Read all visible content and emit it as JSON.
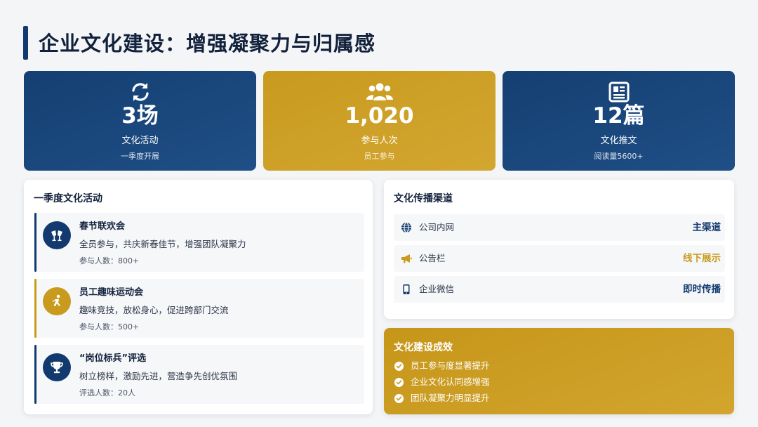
{
  "page": {
    "title": "企业文化建设：增强凝聚力与归属感"
  },
  "colors": {
    "navy": "#123a6e",
    "gold": "#c89a1e",
    "text": "#13223c"
  },
  "stats": [
    {
      "icon": "refresh-icon",
      "value": "3场",
      "label": "文化活动",
      "sub": "一季度开展"
    },
    {
      "icon": "people-icon",
      "value": "1,020",
      "label": "参与人次",
      "sub": "员工参与"
    },
    {
      "icon": "newspaper-icon",
      "value": "12篇",
      "label": "文化推文",
      "sub": "阅读量5600+"
    }
  ],
  "activities": {
    "title": "一季度文化活动",
    "items": [
      {
        "icon": "cheers-icon",
        "name": "春节联欢会",
        "desc": "全员参与，共庆新春佳节，增强团队凝聚力",
        "count": "参与人数：800+"
      },
      {
        "icon": "running-icon",
        "name": "员工趣味运动会",
        "desc": "趣味竞技，放松身心，促进跨部门交流",
        "count": "参与人数：500+"
      },
      {
        "icon": "trophy-icon",
        "name": "“岗位标兵”评选",
        "desc": "树立榜样，激励先进，营造争先创优氛围",
        "count": "评选人数：20人"
      }
    ]
  },
  "channels": {
    "title": "文化传播渠道",
    "items": [
      {
        "icon": "globe-icon",
        "name": "公司内网",
        "tag": "主渠道"
      },
      {
        "icon": "megaphone-icon",
        "name": "公告栏",
        "tag": "线下展示"
      },
      {
        "icon": "mobile-icon",
        "name": "企业微信",
        "tag": "即时传播"
      }
    ]
  },
  "effects": {
    "title": "文化建设成效",
    "items": [
      "员工参与度显著提升",
      "企业文化认同感增强",
      "团队凝聚力明显提升"
    ]
  }
}
